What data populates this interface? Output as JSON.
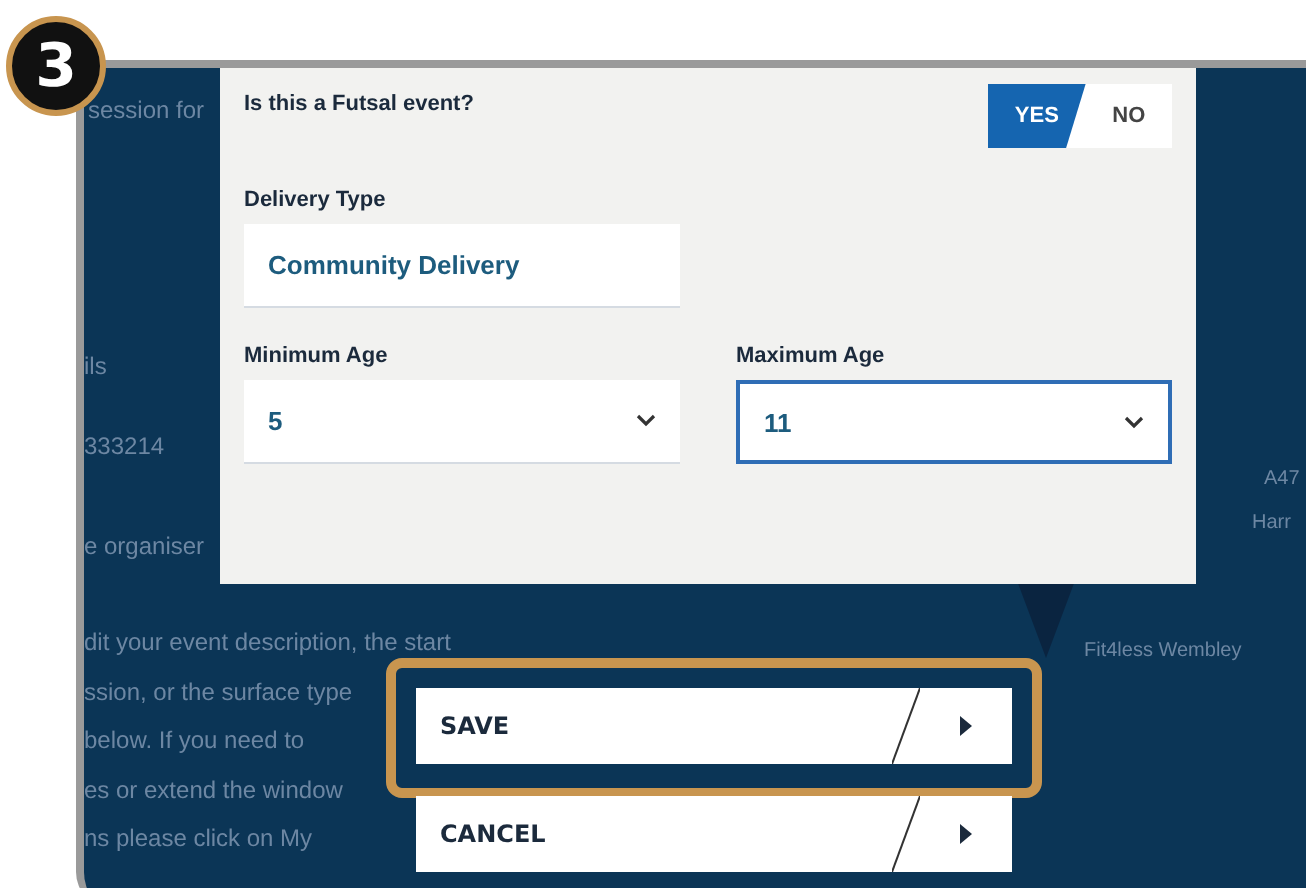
{
  "step_badge": "3",
  "background": {
    "texts": [
      "session for",
      "ils",
      "333214",
      "e organiser",
      "dit your event description, the start",
      "ssion, or the surface type",
      "below. If you need to",
      "es or extend the window",
      "ns please click on My"
    ],
    "map_labels": [
      "A47",
      "Harr",
      "Fit4less Wembley"
    ]
  },
  "modal": {
    "futsal": {
      "label": "Is this a Futsal event?",
      "options": [
        {
          "label": "YES",
          "selected": true
        },
        {
          "label": "NO",
          "selected": false
        }
      ]
    },
    "delivery_type": {
      "label": "Delivery Type",
      "value": "Community Delivery"
    },
    "minimum_age": {
      "label": "Minimum Age",
      "value": "5",
      "focused": false
    },
    "maximum_age": {
      "label": "Maximum Age",
      "value": "11",
      "focused": true
    }
  },
  "buttons": [
    {
      "label": "SAVE",
      "highlighted": true
    },
    {
      "label": "CANCEL",
      "highlighted": false
    }
  ]
}
